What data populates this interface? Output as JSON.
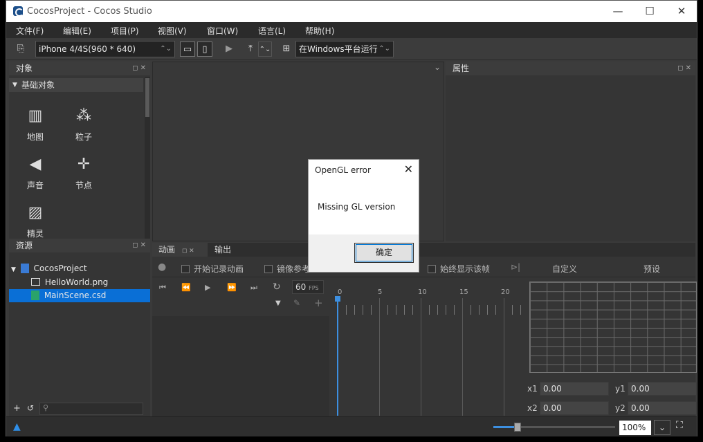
{
  "window": {
    "title": "CocosProject - Cocos Studio",
    "minimize": "—",
    "maximize": "☐",
    "close": "✕"
  },
  "menu": [
    "文件(F)",
    "编辑(E)",
    "项目(P)",
    "视图(V)",
    "窗口(W)",
    "语言(L)",
    "帮助(H)"
  ],
  "toolbar": {
    "device": "iPhone 4/4S(960 * 640)",
    "run_target": "在Windows平台运行"
  },
  "objects_panel": {
    "title": "对象",
    "category": "基础对象",
    "items": [
      "地图",
      "粒子",
      "声音",
      "节点",
      "精灵"
    ]
  },
  "resources_panel": {
    "title": "资源",
    "project": "CocosProject",
    "files": [
      "HelloWorld.png",
      "MainScene.csd"
    ]
  },
  "properties_panel": {
    "title": "属性"
  },
  "animation_panel": {
    "tabs": [
      "动画",
      "输出"
    ],
    "record_label": "开始记录动画",
    "mirror_label": "镜像参考",
    "always_show_label": "始终显示该帧",
    "custom_label": "自定义",
    "preset_label": "预设",
    "fps_value": "60",
    "fps_label": "FPS",
    "ruler": [
      "0",
      "5",
      "10",
      "15",
      "20"
    ],
    "coords": {
      "x1_label": "x1",
      "x1": "0.00",
      "y1_label": "y1",
      "y1": "0.00",
      "x2_label": "x2",
      "x2": "0.00",
      "y2_label": "y2",
      "y2": "0.00"
    }
  },
  "status": {
    "zoom": "100%"
  },
  "dialog": {
    "title": "OpenGL error",
    "message": "Missing GL version",
    "ok": "确定"
  }
}
